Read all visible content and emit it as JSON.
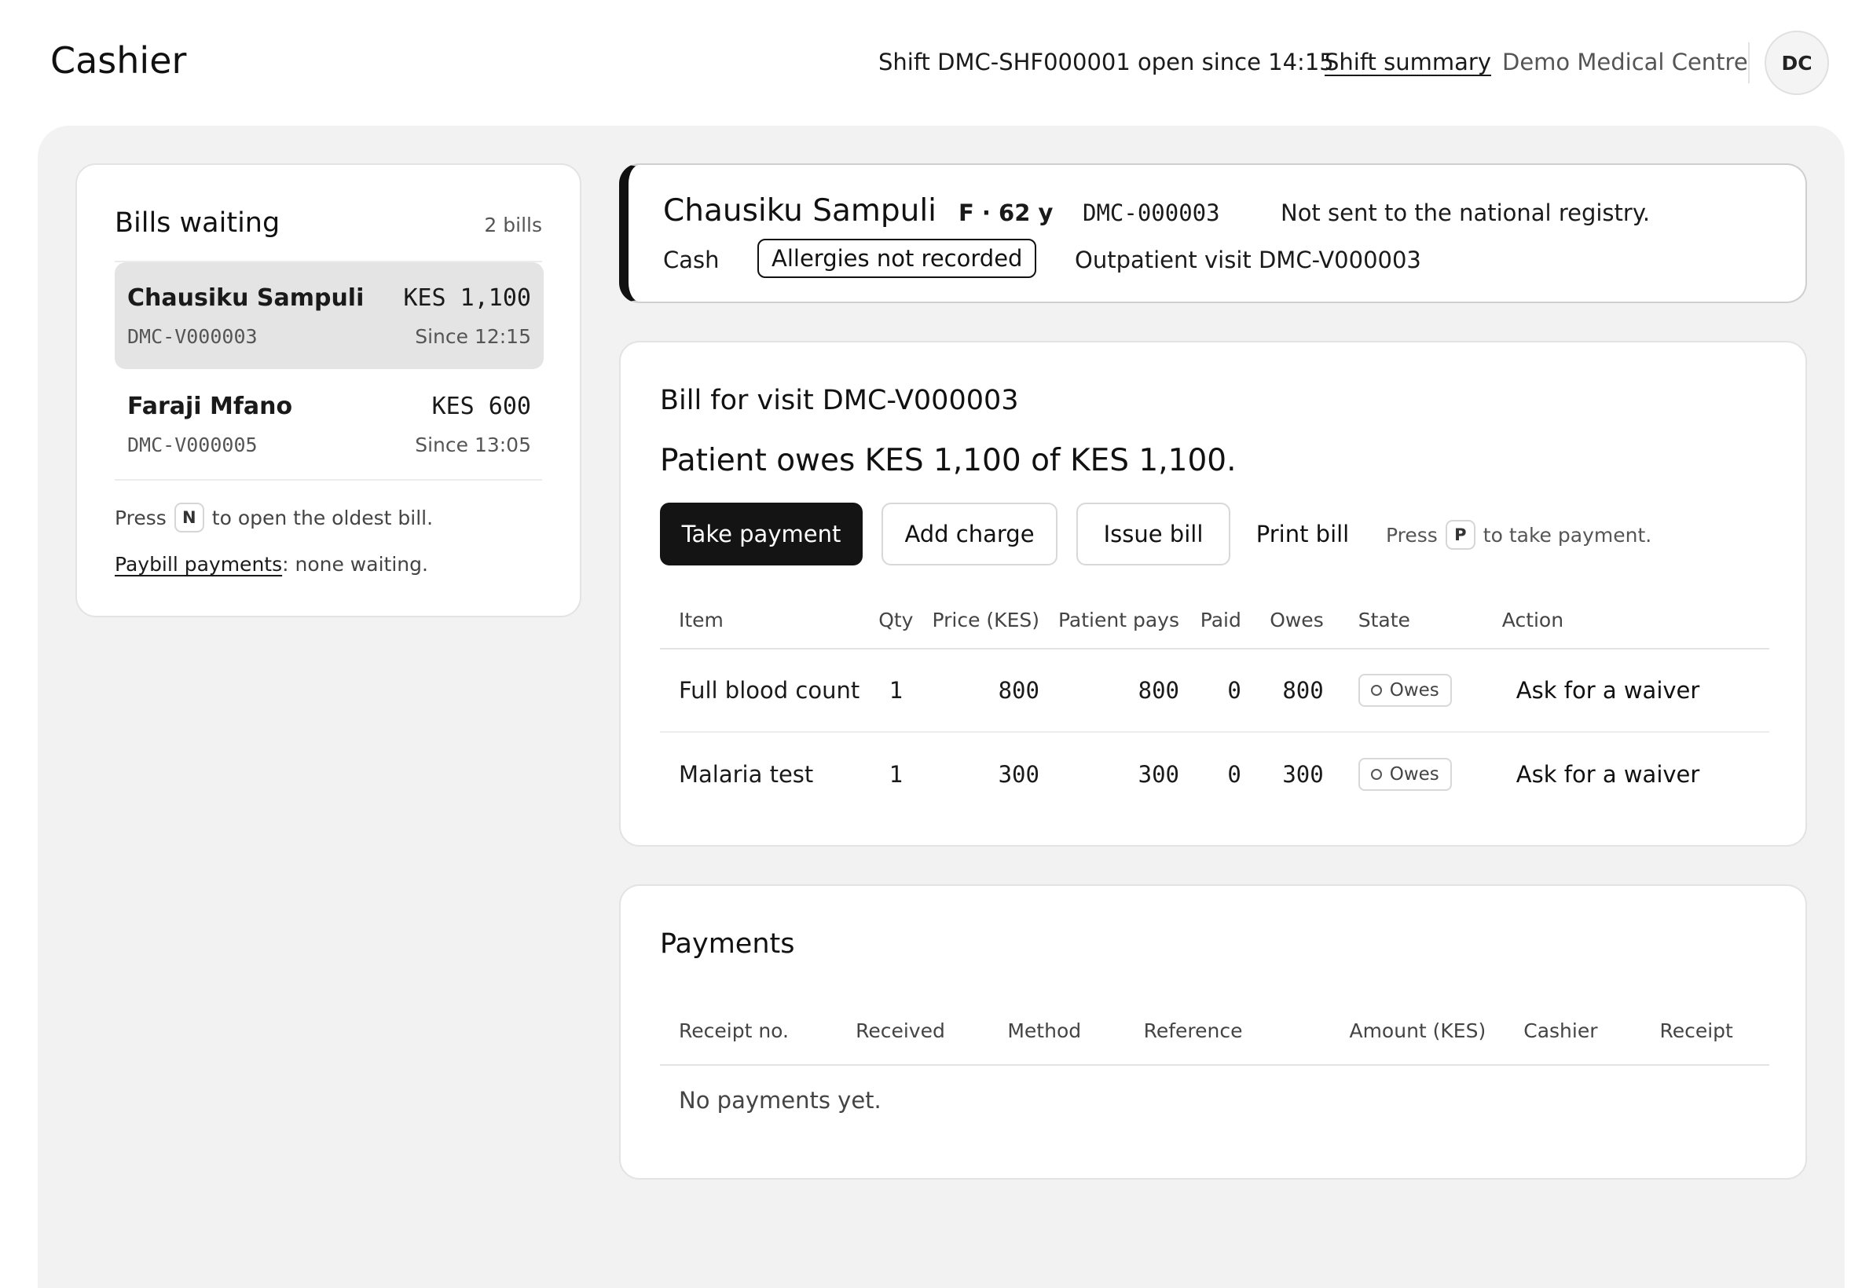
{
  "header": {
    "title": "Cashier",
    "shift_text": "Shift DMC-SHF000001 open since 14:15",
    "shift_summary_label": "Shift summary",
    "facility": "Demo Medical Centre",
    "avatar_initials": "DC"
  },
  "bills_panel": {
    "heading": "Bills waiting",
    "count": "2 bills",
    "items": [
      {
        "name": "Chausiku Sampuli",
        "amount": "KES 1,100",
        "visit": "DMC-V000003",
        "since": "Since 12:15",
        "selected": true
      },
      {
        "name": "Faraji Mfano",
        "amount": "KES 600",
        "visit": "DMC-V000005",
        "since": "Since 13:05",
        "selected": false
      }
    ],
    "hint_press": "Press",
    "hint_key": "N",
    "hint_rest": "to open the oldest bill.",
    "paybill_link": "Paybill payments",
    "paybill_rest": ": none waiting."
  },
  "patient": {
    "name": "Chausiku Sampuli",
    "sex_age": "F · 62 y",
    "id": "DMC-000003",
    "registry_status": "Not sent to the national registry.",
    "payer": "Cash",
    "allergy_badge": "Allergies not recorded",
    "visit": "Outpatient visit DMC-V000003"
  },
  "bill": {
    "title": "Bill for visit DMC-V000003",
    "owes_summary": "Patient owes KES 1,100 of KES 1,100.",
    "take_payment_label": "Take payment",
    "add_charge_label": "Add charge",
    "issue_bill_label": "Issue bill",
    "print_bill_label": "Print bill",
    "hint_press": "Press",
    "hint_key": "P",
    "hint_rest": "to take payment.",
    "columns": {
      "item": "Item",
      "qty": "Qty",
      "price": "Price (KES)",
      "patient_pays": "Patient pays",
      "paid": "Paid",
      "owes": "Owes",
      "state": "State",
      "action": "Action"
    },
    "rows": [
      {
        "item": "Full blood count",
        "qty": "1",
        "price": "800",
        "patient_pays": "800",
        "paid": "0",
        "owes": "800",
        "state": "Owes",
        "action": "Ask for a waiver"
      },
      {
        "item": "Malaria test",
        "qty": "1",
        "price": "300",
        "patient_pays": "300",
        "paid": "0",
        "owes": "300",
        "state": "Owes",
        "action": "Ask for a waiver"
      }
    ]
  },
  "payments": {
    "title": "Payments",
    "columns": {
      "receipt_no": "Receipt no.",
      "received": "Received",
      "method": "Method",
      "reference": "Reference",
      "amount": "Amount (KES)",
      "cashier": "Cashier",
      "receipt": "Receipt"
    },
    "empty_text": "No payments yet."
  },
  "colors": {
    "accent": "#141414",
    "background_panel": "#f2f2f2",
    "selected_row": "#e4e4e4"
  }
}
